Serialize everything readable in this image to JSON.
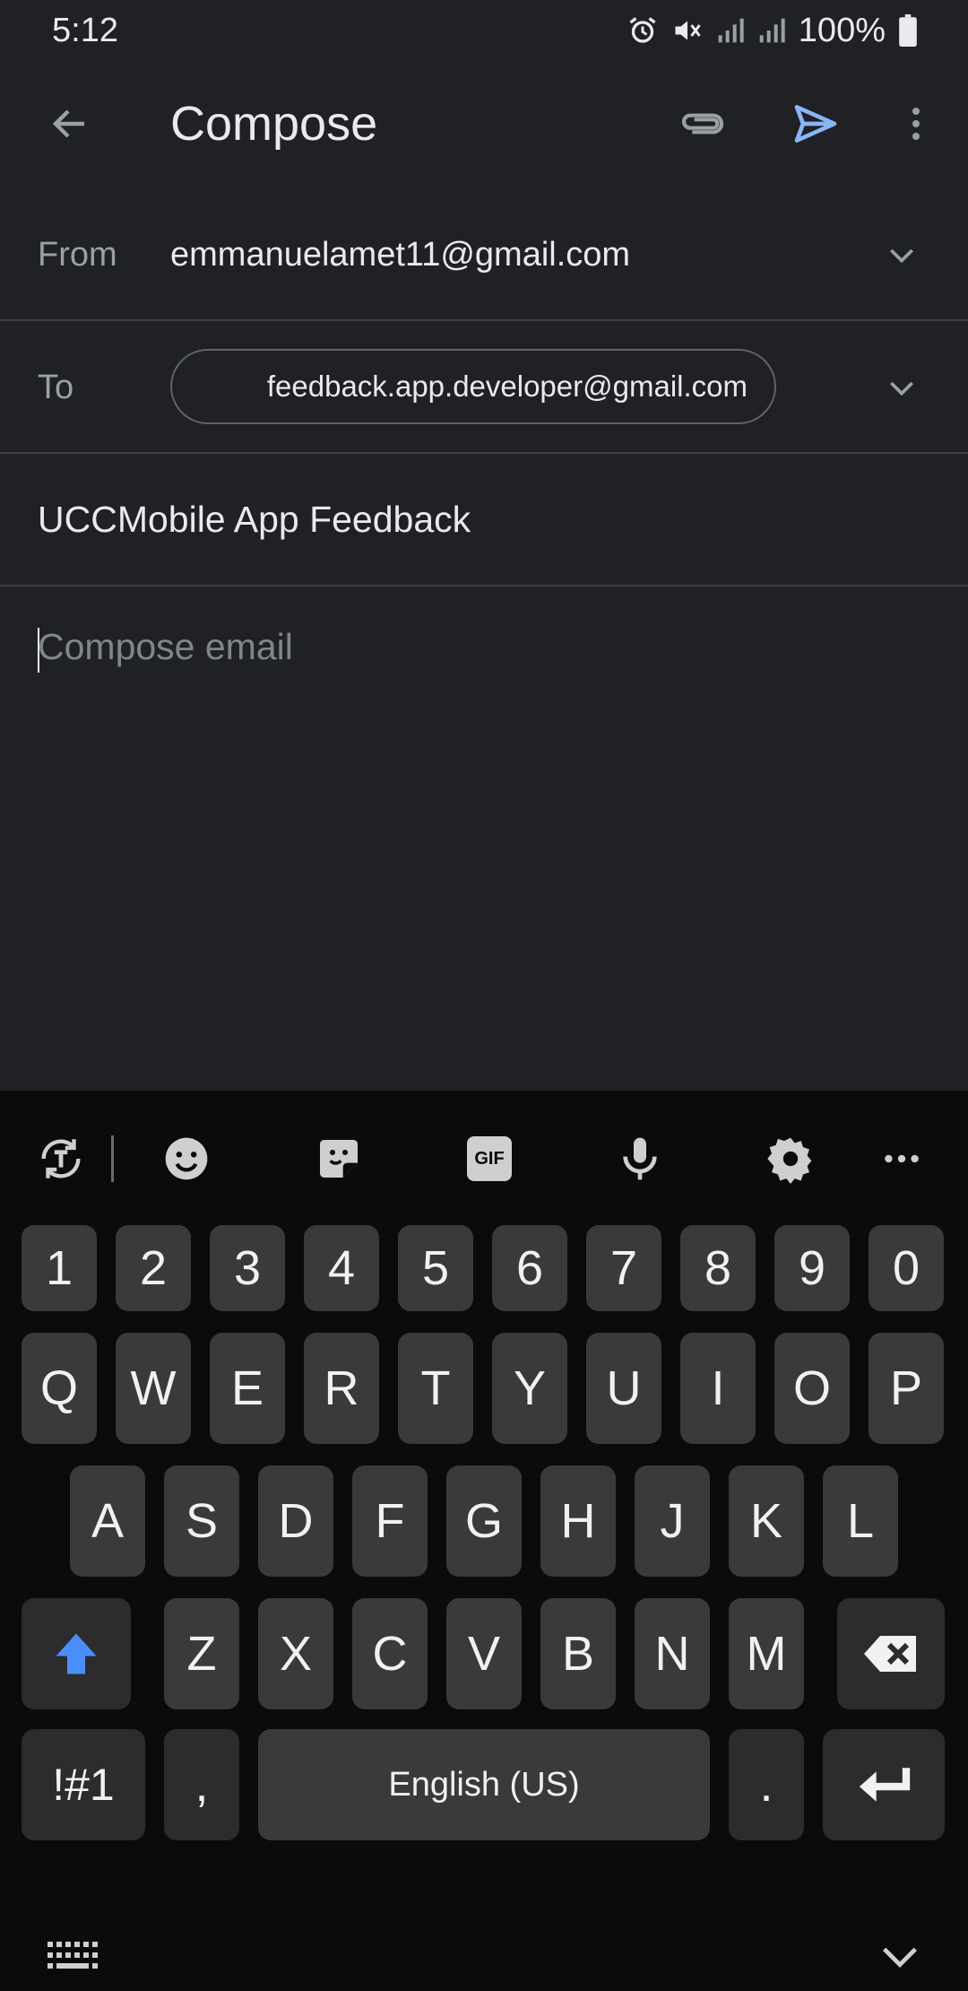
{
  "status_bar": {
    "time": "5:12",
    "battery": "100%",
    "icons": [
      "alarm-icon",
      "mute-icon",
      "signal-icon",
      "signal-icon",
      "battery-icon"
    ]
  },
  "app_bar": {
    "title": "Compose",
    "icons": [
      "back-arrow-icon",
      "paperclip-icon",
      "send-icon",
      "more-vert-icon"
    ],
    "send_color": "#8ab4f8"
  },
  "compose": {
    "from_label": "From",
    "from_value": "emmanuelamet11@gmail.com",
    "to_label": "To",
    "to_chip": "feedback.app.developer@gmail.com",
    "subject": "UCCMobile App Feedback",
    "body_placeholder": "Compose email"
  },
  "keyboard": {
    "toolbar_icons": [
      "text-translate-icon",
      "emoji-icon",
      "sticker-icon",
      "gif-icon",
      "microphone-icon",
      "settings-gear-icon",
      "more-horizontal-icon"
    ],
    "gif_label": "GIF",
    "row_numbers": [
      "1",
      "2",
      "3",
      "4",
      "5",
      "6",
      "7",
      "8",
      "9",
      "0"
    ],
    "row_q": [
      "Q",
      "W",
      "E",
      "R",
      "T",
      "Y",
      "U",
      "I",
      "O",
      "P"
    ],
    "row_a": [
      "A",
      "S",
      "D",
      "F",
      "G",
      "H",
      "J",
      "K",
      "L"
    ],
    "row_z": [
      "Z",
      "X",
      "C",
      "V",
      "B",
      "N",
      "M"
    ],
    "symbols_label": "!#1",
    "comma_label": ",",
    "space_label": "English (US)",
    "period_label": ".",
    "shift_color": "#4a8ff7"
  }
}
